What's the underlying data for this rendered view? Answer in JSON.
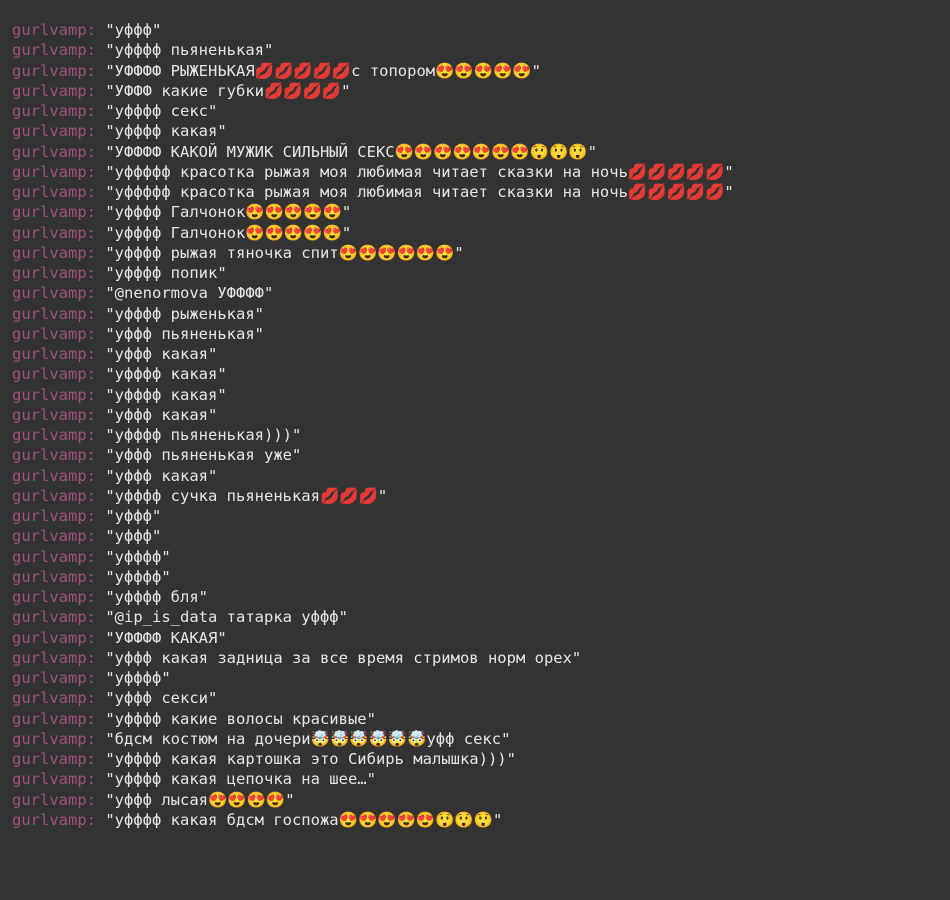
{
  "log": {
    "username": "gurlvamp",
    "separator": ":",
    "messages": [
      "\"уффф\"",
      "\"уфффф пьяненькая\"",
      "\"УФФФФ РЫЖЕНЬКАЯ💋💋💋💋💋с топором😍😍😍😍😍\"",
      "\"УФФФ какие губки💋💋💋💋\"",
      "\"уфффф секс\"",
      "\"уфффф какая\"",
      "\"УФФФФ КАКОЙ МУЖИК СИЛЬНЫЙ СЕКС😍😍😍😍😍😍😍😲😲😲\"",
      "\"уффффф красотка рыжая моя любимая читает сказки на ночь💋💋💋💋💋\"",
      "\"уффффф красотка рыжая моя любимая читает сказки на ночь💋💋💋💋💋\"",
      "\"уфффф Галчонок😍😍😍😍😍\"",
      "\"уфффф Галчонок😍😍😍😍😍\"",
      "\"уфффф рыжая тяночка спит😍😍😍😍😍😍\"",
      "\"уфффф попик\"",
      "\"@nenormova УФФФФ\"",
      "\"уфффф рыженькая\"",
      "\"уффф пьяненькая\"",
      "\"уффф какая\"",
      "\"уфффф какая\"",
      "\"уфффф какая\"",
      "\"уффф какая\"",
      "\"уфффф пьяненькая)))\"",
      "\"уффф пьяненькая уже\"",
      "\"уффф какая\"",
      "\"уфффф сучка пьяненькая💋💋💋\"",
      "\"уффф\"",
      "\"уффф\"",
      "\"уфффф\"",
      "\"уфффф\"",
      "\"уфффф бля\"",
      "\"@ip_is_data татарка уффф\"",
      "\"УФФФФ КАКАЯ\"",
      "\"уффф какая задница за все время стримов норм орех\"",
      "\"уфффф\"",
      "\"уффф секси\"",
      "\"уфффф какие волосы красивые\"",
      "\"бдсм костюм на дочери🤯🤯🤯🤯🤯🤯уфф секс\"",
      "\"уфффф какая картошка это Сибирь малышка)))\"",
      "\"уфффф какая цепочка на шее…\"",
      "\"уффф лысая😍😍😍😍\"",
      "\"уфффф какая бдсм госпожа😍😍😍😍😍😲😲😲\""
    ]
  }
}
